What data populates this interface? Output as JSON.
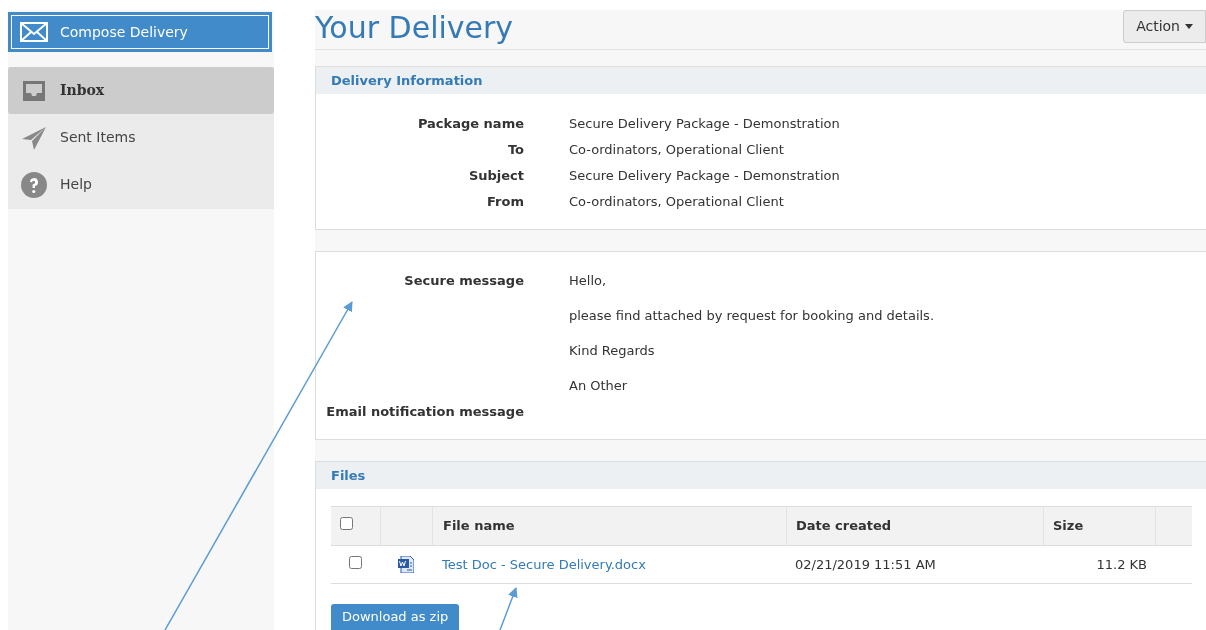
{
  "sidebar": {
    "compose_button": "Compose Delivery",
    "items": [
      {
        "label": "Inbox",
        "kind": "inbox",
        "selected": true
      },
      {
        "label": "Sent Items",
        "kind": "send",
        "selected": false
      },
      {
        "label": "Help",
        "kind": "help",
        "selected": false
      }
    ]
  },
  "page": {
    "title": "Your Delivery",
    "action_button": "Action"
  },
  "delivery_information": {
    "heading": "Delivery Information",
    "fields": [
      {
        "label": "Package name",
        "value": "Secure Delivery Package - Demonstration"
      },
      {
        "label": "To",
        "value": "Co-ordinators, Operational Client"
      },
      {
        "label": "Subject",
        "value": "Secure Delivery Package - Demonstration"
      },
      {
        "label": "From",
        "value": "Co-ordinators, Operational Client"
      }
    ]
  },
  "messages": {
    "secure_message_label": "Secure message",
    "secure_message_lines": [
      "Hello,",
      "please find attached by request for booking and details.",
      "Kind Regards",
      "An Other"
    ],
    "notification_label": "Email notification message"
  },
  "files": {
    "heading": "Files",
    "columns": [
      "File name",
      "Date created",
      "Size"
    ],
    "select_all_checked": false,
    "rows": [
      {
        "checked": false,
        "file_name": "Test Doc - Secure Delivery.docx",
        "date_created": "02/21/2019 11:51 AM",
        "size": "11.2 KB"
      }
    ],
    "download_button": "Download as zip"
  }
}
